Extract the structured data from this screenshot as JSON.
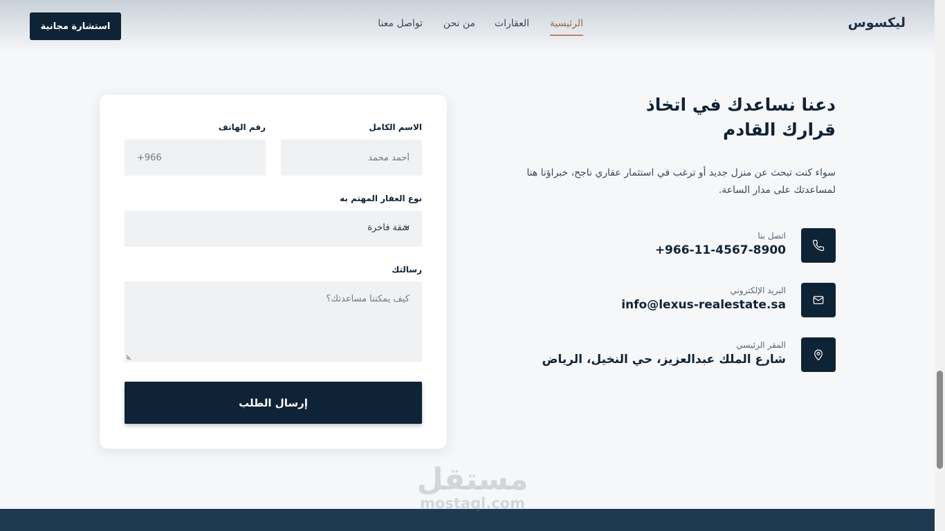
{
  "header": {
    "logo": "ليكسوس",
    "nav": [
      {
        "label": "الرئيسية",
        "active": true
      },
      {
        "label": "العقارات",
        "active": false
      },
      {
        "label": "من نحن",
        "active": false
      },
      {
        "label": "تواصل معنا",
        "active": false
      }
    ],
    "cta_label": "استشارة مجانية"
  },
  "info": {
    "heading_line1": "دعنا نساعدك في اتخاذ",
    "heading_line2": "قرارك القادم",
    "description": "سواء كنت تبحث عن منزل جديد أو ترغب في استثمار عقاري ناجح، خبراؤنا هنا لمساعدتك على مدار الساعة.",
    "contacts": [
      {
        "icon": "phone-icon",
        "label": "اتصل بنا",
        "value": "+966-11-4567-8900"
      },
      {
        "icon": "mail-icon",
        "label": "البريد الإلكتروني",
        "value": "info@lexus-realestate.sa"
      },
      {
        "icon": "location-pin-icon",
        "label": "المقر الرئيسي",
        "value": "شارع الملك عبدالعزيز، حي النخيل، الرياض"
      }
    ]
  },
  "form": {
    "name_label": "الاسم الكامل",
    "name_placeholder": "أحمد محمد",
    "phone_label": "رقم الهاتف",
    "phone_placeholder": "+966",
    "type_label": "نوع العقار المهتم به",
    "type_selected": "شقة فاخرة",
    "message_label": "رسالتك",
    "message_placeholder": "كيف يمكننا مساعدتك؟",
    "submit_label": "إرسال الطلب"
  },
  "watermark": {
    "arabic": "مستقل",
    "latin": "mostaql.com"
  },
  "colors": {
    "primary": "#0f2336",
    "accent": "#b9876a",
    "footer": "#1e3a52"
  }
}
